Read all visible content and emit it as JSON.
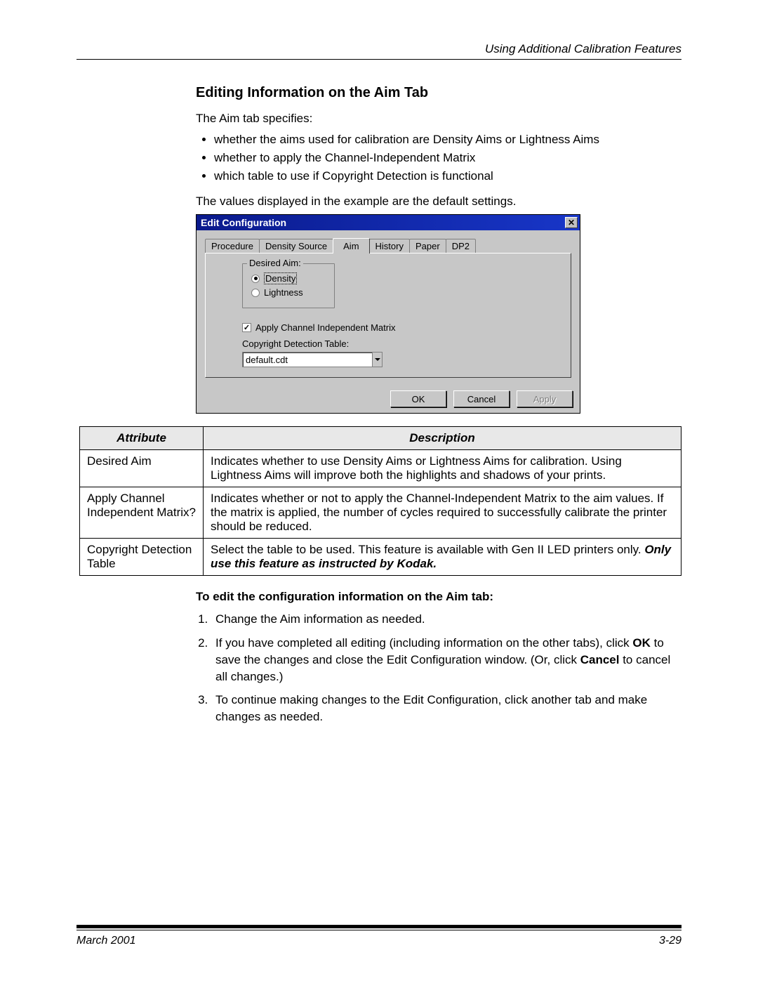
{
  "header": {
    "right": "Using Additional Calibration Features"
  },
  "title": "Editing Information on the Aim Tab",
  "intro": "The Aim tab specifies:",
  "bullets": [
    "whether the aims used for calibration are Density Aims or Lightness Aims",
    "whether to apply the Channel-Independent Matrix",
    "which table to use if Copyright Detection is functional"
  ],
  "defaults_note": "The values displayed in the example are the default settings.",
  "dialog": {
    "title": "Edit Configuration",
    "close": "✕",
    "tabs": {
      "t0": "Procedure",
      "t1": "Density Source",
      "t2": "Aim",
      "t3": "History",
      "t4": "Paper",
      "t5": "DP2"
    },
    "group_label": "Desired Aim:",
    "radio_density": "Density",
    "radio_lightness": "Lightness",
    "apply_matrix": "Apply Channel Independent Matrix",
    "apply_matrix_check": "✓",
    "cdt_label": "Copyright Detection Table:",
    "cdt_value": "default.cdt",
    "btn_ok": "OK",
    "btn_cancel": "Cancel",
    "btn_apply": "Apply"
  },
  "table": {
    "head_attr": "Attribute",
    "head_desc": "Description",
    "rows": [
      {
        "attr": "Desired Aim",
        "desc": "Indicates whether to use Density Aims or Lightness Aims for calibration. Using Lightness Aims will improve both the highlights and shadows of your prints."
      },
      {
        "attr": "Apply Channel Independent Matrix?",
        "desc": "Indicates whether or not to apply the Channel-Independent Matrix to the aim values. If the matrix is applied, the number of cycles required to successfully calibrate the printer should be reduced."
      },
      {
        "attr": "Copyright Detection Table",
        "desc_pre": "Select the table to be used. This feature is available with Gen II LED printers only. ",
        "desc_bold": "Only use this feature as instructed by Kodak."
      }
    ]
  },
  "subhead": "To edit the configuration information on the Aim tab:",
  "steps": {
    "s1": "Change the Aim information as needed.",
    "s2_a": "If you have completed all editing (including information on the other tabs), click ",
    "s2_ok": "OK",
    "s2_b": " to save the changes and close the Edit Configuration window. (Or, click ",
    "s2_cancel": "Cancel",
    "s2_c": " to cancel all changes.)",
    "s3": "To continue making changes to the Edit Configuration, click another tab and make changes as needed."
  },
  "footer": {
    "left": "March 2001",
    "right": "3-29"
  }
}
